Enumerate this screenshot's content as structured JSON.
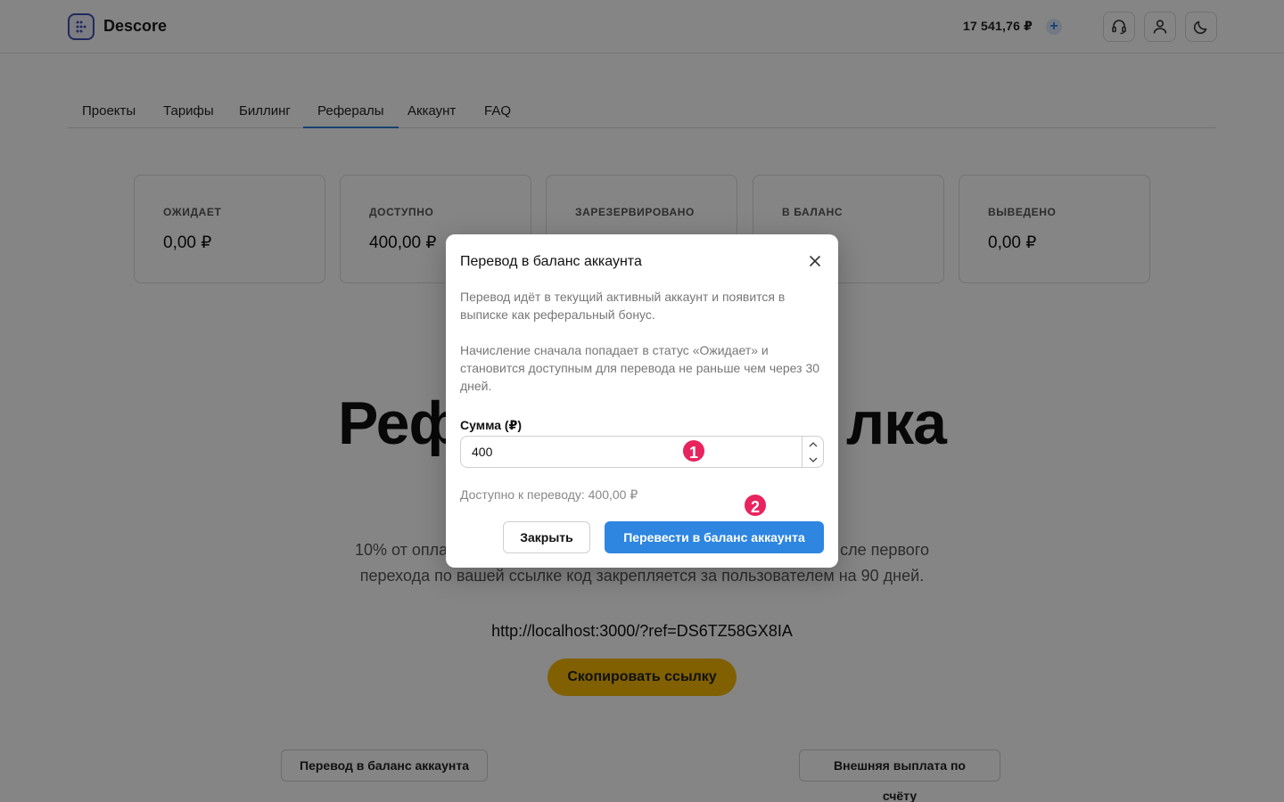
{
  "header": {
    "brand": "Descore",
    "balance": "17 541,76 ₽",
    "plus_label": "+"
  },
  "tabs": [
    {
      "label": "Проекты",
      "active": false
    },
    {
      "label": "Тарифы",
      "active": false
    },
    {
      "label": "Биллинг",
      "active": false
    },
    {
      "label": "Рефералы",
      "active": true
    },
    {
      "label": "Аккаунт",
      "active": false
    },
    {
      "label": "FAQ",
      "active": false
    }
  ],
  "stats": [
    {
      "label": "ОЖИДАЕТ",
      "value": "0,00 ₽"
    },
    {
      "label": "ДОСТУПНО",
      "value": "400,00 ₽"
    },
    {
      "label": "ЗАРЕЗЕРВИРОВАНО",
      "value": ""
    },
    {
      "label": "В БАЛАНС",
      "value": ""
    },
    {
      "label": "ВЫВЕДЕНО",
      "value": "0,00 ₽"
    }
  ],
  "hero": {
    "title_left": "Реф",
    "title_right": "лка",
    "desc_line1_left": "10% от опла",
    "desc_line1_right": "сле первого",
    "desc_line2": "перехода по вашей ссылке код закрепляется за пользователем на 90 дней.",
    "link": "http://localhost:3000/?ref=DS6TZ58GX8IA",
    "copy_label": "Скопировать ссылку",
    "transfer_label": "Перевод в баланс аккаунта",
    "payout_label": "Внешняя выплата по счёту"
  },
  "modal": {
    "title": "Перевод в баланс аккаунта",
    "paragraph1": "Перевод идёт в текущий активный аккаунт и появится в выписке как реферальный бонус.",
    "paragraph2": "Начисление сначала попадает в статус «Ожидает» и становится доступным для перевода не раньше чем через 30 дней.",
    "amount_label": "Сумма (₽)",
    "amount_value": "400",
    "available": "Доступно к переводу: 400,00 ₽",
    "close_label": "Закрыть",
    "submit_label": "Перевести в баланс аккаунта"
  },
  "markers": [
    "1",
    "2"
  ],
  "colors": {
    "accent": "#2e86e0",
    "copy_button": "#f5b800",
    "marker": "#e8245f"
  }
}
